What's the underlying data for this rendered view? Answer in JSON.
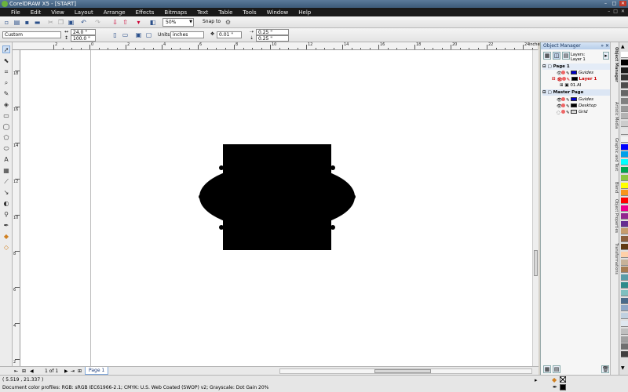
{
  "title": "CorelDRAW X5 - [START]",
  "window_controls": [
    "–",
    "□",
    "✕"
  ],
  "menu": [
    "File",
    "Edit",
    "View",
    "Layout",
    "Arrange",
    "Effects",
    "Bitmaps",
    "Text",
    "Table",
    "Tools",
    "Window",
    "Help"
  ],
  "toolbar": {
    "zoom": "50%",
    "snap_to": "Snap to"
  },
  "propbar": {
    "preset": "Custom",
    "width": "24.0 \"",
    "height": "100.0 \"",
    "units_label": "Units:",
    "units": "inches",
    "nudge": "0.01 \"",
    "dup_x": "0.25 \"",
    "dup_y": "0.25 \""
  },
  "ruler": {
    "top": [
      "2",
      "0",
      "2",
      "4",
      "6",
      "8",
      "10",
      "12",
      "14",
      "16",
      "18",
      "20",
      "22",
      "24"
    ],
    "left": [
      "18",
      "16",
      "14",
      "12",
      "10",
      "8",
      "6",
      "4",
      "2"
    ],
    "unit": "inches"
  },
  "docker": {
    "title": "Object Manager",
    "layer_caption": "Layers:",
    "layer_name": "Layer 1",
    "tree": [
      {
        "label": "Page 1",
        "kind": "section"
      },
      {
        "label": "Guides",
        "kind": "layer",
        "color": "#0000cc"
      },
      {
        "label": "Layer 1",
        "kind": "layer-active",
        "color": "#000000"
      },
      {
        "label": "01.AI",
        "kind": "object"
      },
      {
        "label": "Master Page",
        "kind": "master"
      },
      {
        "label": "Guides",
        "kind": "layer",
        "color": "#0000cc"
      },
      {
        "label": "Desktop",
        "kind": "layer",
        "color": "#000000"
      },
      {
        "label": "Grid",
        "kind": "layer",
        "color": "#d8d8d8"
      }
    ]
  },
  "side_tabs": [
    "Object Manager",
    "Artistic Media",
    "Graphic and Text",
    "Blend",
    "Object Properties",
    "Transformations"
  ],
  "page_nav": {
    "count": "1 of 1",
    "tab": "Page 1"
  },
  "status": {
    "coords": "( 5.519 , 21.337 )",
    "profiles": "Document color profiles: RGB: sRGB IEC61966-2.1; CMYK: U.S. Web Coated (SWOP) v2; Grayscale: Dot Gain 20%"
  },
  "palette": [
    "#ffffff",
    "#000000",
    "#1a1a1a",
    "#333333",
    "#4d4d4d",
    "#666666",
    "#808080",
    "#999999",
    "#b3b3b3",
    "#cccccc",
    "#e6e6e6",
    "#f2f2f2",
    "#0000ff",
    "#00a0e9",
    "#00ffff",
    "#00a651",
    "#8dc63f",
    "#ffff00",
    "#f7941d",
    "#ff0000",
    "#ec008c",
    "#92278f",
    "#662d91",
    "#c69c6d",
    "#8b5e3c",
    "#603913",
    "#ffd0a8",
    "#c7b299",
    "#a67c52",
    "#5a9ca8",
    "#2e8b8b",
    "#7fbfbf",
    "#4a6a8a",
    "#8fa8c8",
    "#c0d0e0",
    "#e0e8f0",
    "#bfbfbf",
    "#a0a0a0",
    "#707070",
    "#404040"
  ]
}
